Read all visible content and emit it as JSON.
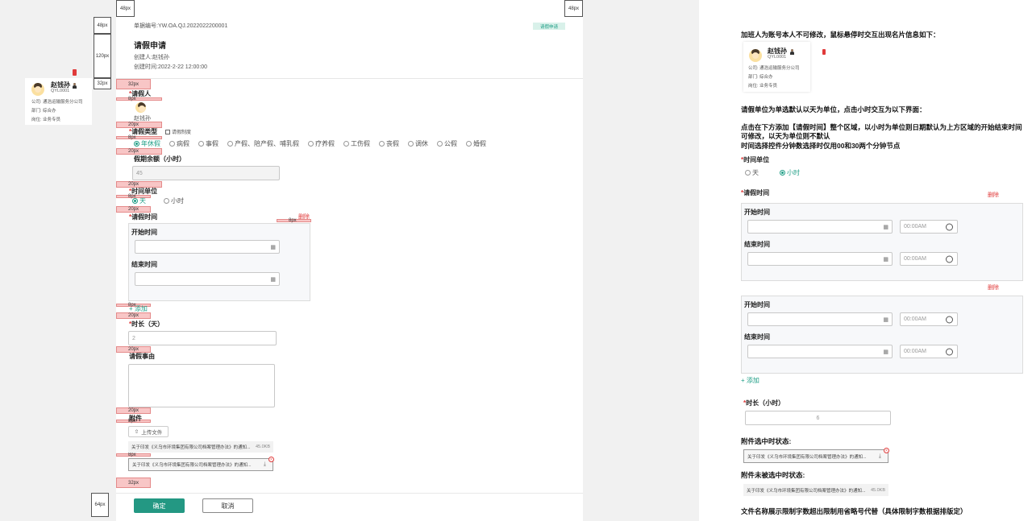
{
  "form": {
    "doc_no": "单据编号:YW.OA.QJ.2022022200001",
    "status_badge": "请假申请",
    "title": "请假申请",
    "creator": "创建人:赵钱孙",
    "created_time": "创建时间:2022-2-22 12:00:00",
    "applicant_label": "请假人",
    "applicant_name": "赵钱孙",
    "leave_type_label": "请假类型",
    "leave_policy": "请假制度",
    "leave_types": [
      "年休假",
      "病假",
      "事假",
      "产假、陪产假、哺乳假",
      "疗养假",
      "工伤假",
      "丧假",
      "调休",
      "公假",
      "婚假"
    ],
    "leave_types_selected": "年休假",
    "balance_label": "假期余额（小时）",
    "balance_value": "45",
    "unit_label": "时间单位",
    "unit_options": [
      "天",
      "小时"
    ],
    "unit_selected": "天",
    "period_label": "请假时间",
    "delete": "删除",
    "start_label": "开始时间",
    "end_label": "结束时间",
    "add": "+ 添加",
    "duration_label": "时长（天）",
    "duration_value": "2",
    "reason_label": "请假事由",
    "attachment_label": "附件",
    "upload": "上传文件",
    "file_name": "关于印发《义乌市环境集团有限公司档案管理办法》的通知...",
    "file_size": "45.0KB",
    "confirm": "确定",
    "cancel": "取消"
  },
  "card": {
    "name": "赵钱孙",
    "id": "QYL0001",
    "company": "公司:  通浩运输服务分公司",
    "dept": "部门:  综合办",
    "post": "岗位:  业务专员"
  },
  "dims": {
    "d48a": "48px",
    "d48b": "48px",
    "d48c": "48px",
    "d120": "120px",
    "d32a": "32px",
    "s32": "32px",
    "s8a": "8px",
    "s20a": "20px",
    "s8b": "8px",
    "s20b": "20px",
    "s20c": "20px",
    "s8c": "8px",
    "s20d": "20px",
    "s8d": "8px",
    "s8e": "8px",
    "s20e": "20px",
    "s20f": "20px",
    "s20g": "20px",
    "s8f": "8px",
    "s8g": "8px",
    "s32b": "32px",
    "d64": "64px"
  },
  "notes": {
    "n1": "加班人为账号本人不可修改，鼠标悬停时交互出现名片信息如下：",
    "n2": "请假单位为单选默认以天为单位，点击小时交互为以下界面：",
    "n3": "点击在下方添加【请假时间】整个区域，以小时为单位则日期默认为上方区域的开始结束时间可修改，以天为单位则不默认",
    "n4": "时间选择控件分钟数选择时仅用00和30两个分钟节点",
    "n_unit": "时间单位",
    "n_period": "请假时间",
    "n_delete": "删除",
    "n_start": "开始时间",
    "n_end": "结束时间",
    "n_time": "00:00AM",
    "n_add": "+ 添加",
    "n_duration": "时长（小时）",
    "n_duration_value": "6",
    "n_attach_on": "附件选中时状态:",
    "n_attach_off": "附件未被选中时状态:",
    "n_last": "文件名称展示限制字数超出限制用省略号代替（具体限制字数根据排版定）"
  },
  "colors": {
    "accent": "#1f9e86",
    "danger": "#e03a3a",
    "spacer": "#f8c6c6"
  }
}
